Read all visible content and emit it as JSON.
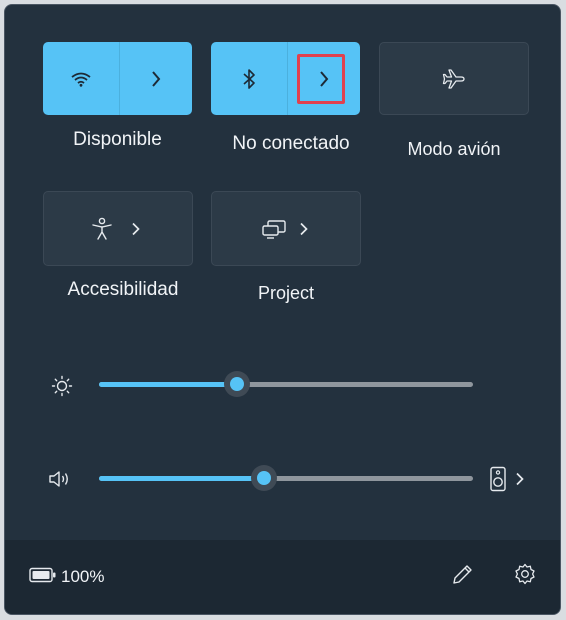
{
  "quick_settings": {
    "tiles": [
      {
        "id": "wifi",
        "label": "Disponible",
        "state": "on"
      },
      {
        "id": "bluetooth",
        "label": "No conectado",
        "state": "on"
      },
      {
        "id": "airplane",
        "label": "Modo avión",
        "state": "off"
      },
      {
        "id": "accessibility",
        "label": "Accesibilidad",
        "state": "off"
      },
      {
        "id": "project",
        "label": "Project",
        "state": "off"
      }
    ],
    "brightness": {
      "value": 0.37
    },
    "volume": {
      "value": 0.44
    },
    "footer": {
      "battery_text": "100%"
    }
  },
  "colors": {
    "accent": "#56c3f6",
    "panel": "#23313e",
    "footer": "#1c2833",
    "highlight": "#e0414f"
  },
  "icons": [
    "wifi-icon",
    "bluetooth-icon",
    "airplane-icon",
    "accessibility-icon",
    "project-icon",
    "brightness-icon",
    "volume-icon",
    "speaker-device-icon",
    "battery-icon",
    "edit-icon",
    "settings-icon"
  ]
}
